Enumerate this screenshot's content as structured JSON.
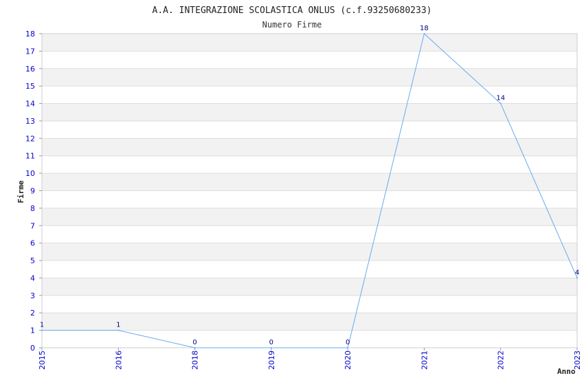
{
  "chart_data": {
    "type": "line",
    "title": "A.A. INTEGRAZIONE SCOLASTICA ONLUS (c.f.93250680233)",
    "subtitle": "Numero Firme",
    "xlabel": "Anno",
    "ylabel": "Firme",
    "x": [
      "2015",
      "2016",
      "2018",
      "2019",
      "2020",
      "2021",
      "2022",
      "2023"
    ],
    "values": [
      1,
      1,
      0,
      0,
      0,
      18,
      14,
      4
    ],
    "data_labels": [
      "1",
      "1",
      "0",
      "0",
      "0",
      "18",
      "14",
      "4"
    ],
    "y_ticks": [
      "0",
      "1",
      "2",
      "3",
      "4",
      "5",
      "6",
      "7",
      "8",
      "9",
      "10",
      "11",
      "12",
      "13",
      "14",
      "15",
      "16",
      "17",
      "18"
    ],
    "ylim": [
      0,
      18
    ],
    "grid": true,
    "colors": {
      "line": "#66aaee",
      "band": "#f2f2f2",
      "tick_text": "#0000cc",
      "data_label": "#000080"
    }
  }
}
